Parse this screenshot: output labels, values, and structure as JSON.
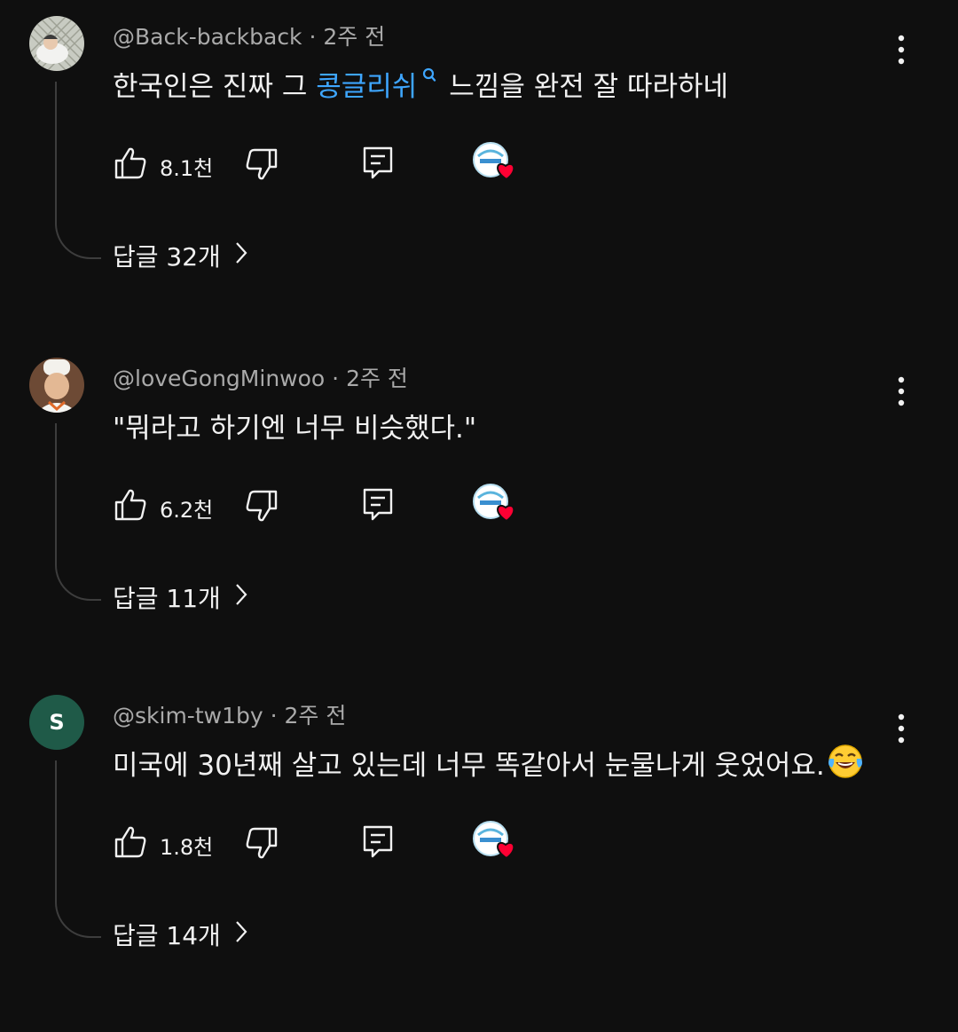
{
  "comments": [
    {
      "handle": "@Back-backback",
      "time": "2주 전",
      "text_before": "한국인은 진짜 그 ",
      "text_link": "콩글리쉬",
      "text_after": "느낌을 완전 잘 따라하네",
      "likes": "8.1천",
      "replies": "답글 32개",
      "avatar": "photo"
    },
    {
      "handle": "@loveGongMinwoo",
      "time": "2주 전",
      "text_before": "\"뭐라고 하기엔 너무 비슷했다.\"",
      "likes": "6.2천",
      "replies": "답글 11개",
      "avatar": "photo-chef"
    },
    {
      "handle": "@skim-tw1by",
      "time": "2주 전",
      "text_before": "미국에 30년째 살고 있는데 너무 똑같아서 눈물나게 웃었어요.",
      "likes": "1.8천",
      "replies": "답글 14개",
      "avatar_letter": "S",
      "avatar": "letter"
    }
  ],
  "meta_separator": "·",
  "icons": {
    "like": "thumbs-up-icon",
    "dislike": "thumbs-down-icon",
    "reply": "reply-icon",
    "more": "more-vert-icon",
    "creator_heart": "creator-heart-icon",
    "search_suggest": "search-icon",
    "laugh": "tears-of-joy-emoji",
    "replies_chevron": "chevron-right-icon"
  },
  "colors": {
    "background": "#0f0f0f",
    "text": "#f1f1f1",
    "meta": "#aaaaaa",
    "link": "#3ea6ff",
    "heart": "#ff0033",
    "letter_avatar": "#1f5a48"
  }
}
